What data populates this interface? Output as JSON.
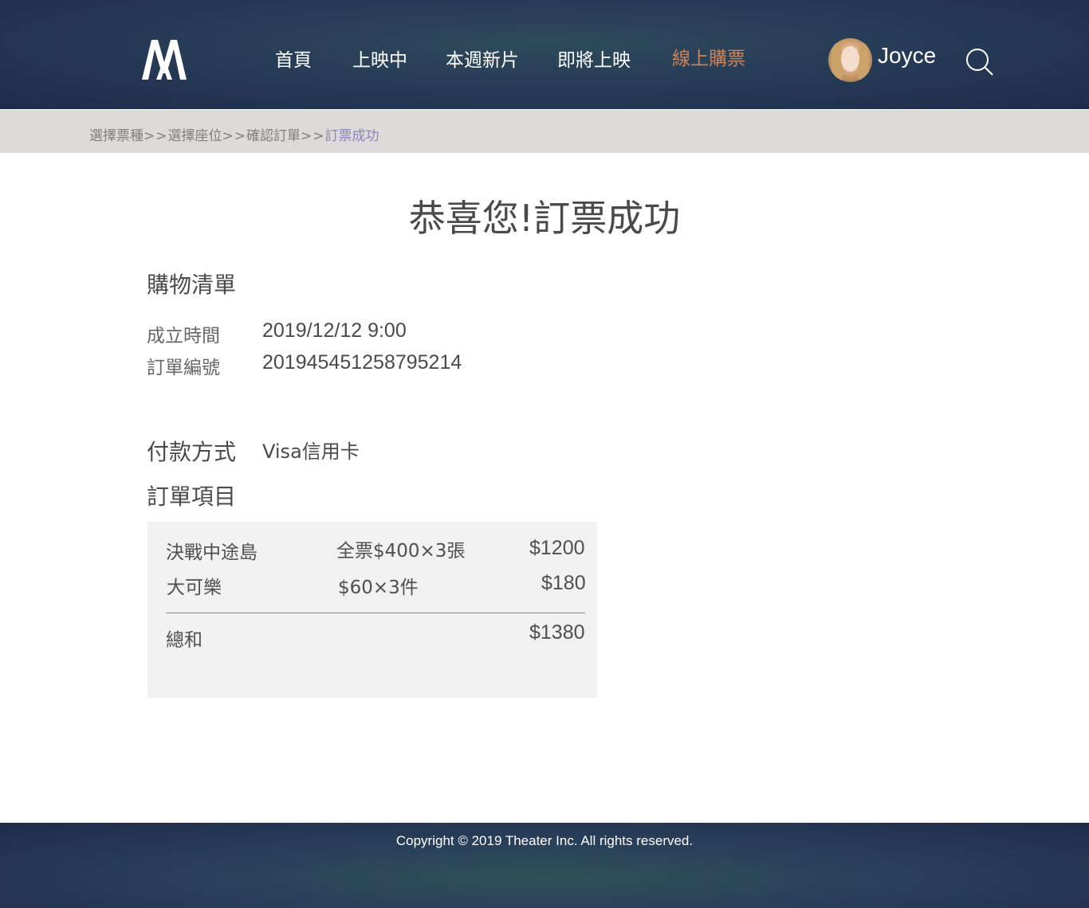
{
  "header": {
    "nav": [
      "首頁",
      "上映中",
      "本週新片",
      "即將上映",
      "線上購票"
    ],
    "active_nav": "線上購票",
    "user_name": "Joyce",
    "colors": {
      "active_nav": "#c8835f",
      "header_bg": "#253955"
    }
  },
  "breadcrumb": {
    "steps": [
      "選擇票種",
      "選擇座位",
      "確認訂單",
      "訂票成功"
    ],
    "separator": ">>",
    "current": "訂票成功"
  },
  "main": {
    "title": "恭喜您!訂票成功",
    "list_title": "購物清單",
    "created_label": "成立時間",
    "created_value": "2019/12/12 9:00",
    "order_no_label": "訂單編號",
    "order_no_value": "201945451258795214",
    "payment_label": "付款方式",
    "payment_value": "Visa信用卡",
    "items_title": "訂單項目",
    "items": [
      {
        "name": "決戰中途島",
        "detail": "全票$400×3張",
        "amount": "$1200"
      },
      {
        "name": "大可樂",
        "detail": "$60×3件",
        "amount": "$180"
      }
    ],
    "total_label": "總和",
    "total_value": "$1380"
  },
  "footer": {
    "copyright": "Copyright © 2019 Theater Inc. All rights reserved."
  },
  "icons": [
    "logo-icon",
    "avatar",
    "search-icon"
  ]
}
